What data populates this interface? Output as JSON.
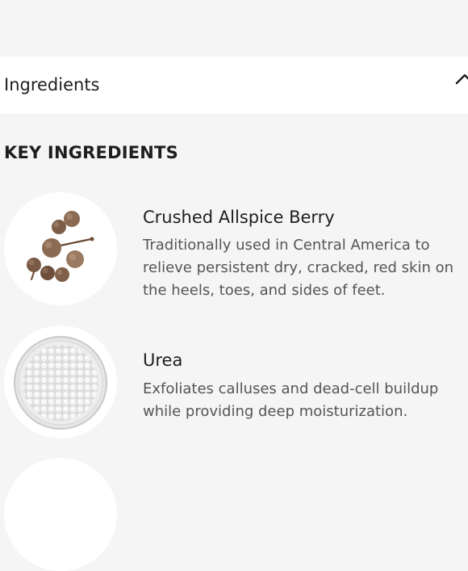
{
  "accordion": {
    "title": "Ingredients",
    "toggle_icon": "chevron-up-icon",
    "expanded": true
  },
  "key_ingredients": {
    "heading": "KEY INGREDIENTS",
    "items": [
      {
        "name": "Crushed Allspice Berry",
        "image_icon": "allspice-berries-image",
        "description_lines": [
          "Traditionally used in Central America to",
          "relieve persistent dry, cracked, red skin on",
          "the heels, toes, and sides of feet."
        ]
      },
      {
        "name": "Urea",
        "image_icon": "urea-beads-dish-image",
        "description_lines": [
          "Exfoliates calluses and dead-cell buildup",
          "while providing deep moisturization."
        ]
      }
    ]
  },
  "colors": {
    "page_background": "#f5f5f5",
    "panel_background": "#ffffff",
    "heading_text": "#1e1e1e",
    "body_text": "#555555"
  }
}
